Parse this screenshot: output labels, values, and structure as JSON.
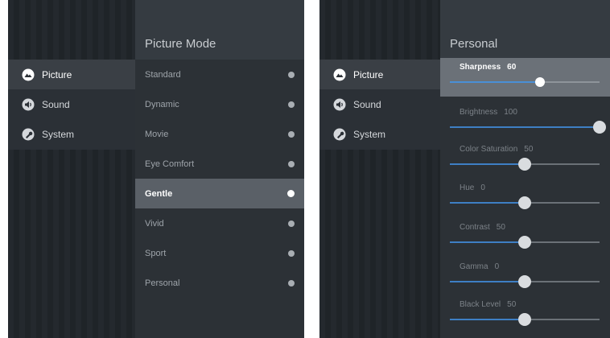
{
  "left_screen": {
    "sidebar": {
      "items": [
        {
          "label": "Picture",
          "icon": "picture-icon",
          "active": true
        },
        {
          "label": "Sound",
          "icon": "sound-icon",
          "active": false
        },
        {
          "label": "System",
          "icon": "wrench-icon",
          "active": false
        }
      ]
    },
    "content": {
      "title": "Picture Mode",
      "modes": [
        {
          "label": "Standard"
        },
        {
          "label": "Dynamic"
        },
        {
          "label": "Movie"
        },
        {
          "label": "Eye Comfort"
        },
        {
          "label": "Gentle",
          "selected": true
        },
        {
          "label": "Vivid"
        },
        {
          "label": "Sport"
        },
        {
          "label": "Personal"
        }
      ]
    }
  },
  "right_screen": {
    "sidebar": {
      "items": [
        {
          "label": "Picture",
          "icon": "picture-icon",
          "active": true
        },
        {
          "label": "Sound",
          "icon": "sound-icon",
          "active": false
        },
        {
          "label": "System",
          "icon": "wrench-icon",
          "active": false
        }
      ]
    },
    "content": {
      "title": "Personal",
      "sliders": [
        {
          "label": "Sharpness",
          "value": "60",
          "level": 0.6,
          "focused": true
        },
        {
          "label": "Brightness",
          "value": "100",
          "level": 1.0
        },
        {
          "label": "Color Saturation",
          "value": "50",
          "level": 0.5
        },
        {
          "label": "Hue",
          "value": "0",
          "level": 0.5
        },
        {
          "label": "Contrast",
          "value": "50",
          "level": 0.5
        },
        {
          "label": "Gamma",
          "value": "0",
          "level": 0.5
        },
        {
          "label": "Black Level",
          "value": "50",
          "level": 0.5
        }
      ]
    }
  },
  "colors": {
    "accent": "#3e7fc4",
    "panel": "#1f2328",
    "selected_row": "#5a6067"
  }
}
